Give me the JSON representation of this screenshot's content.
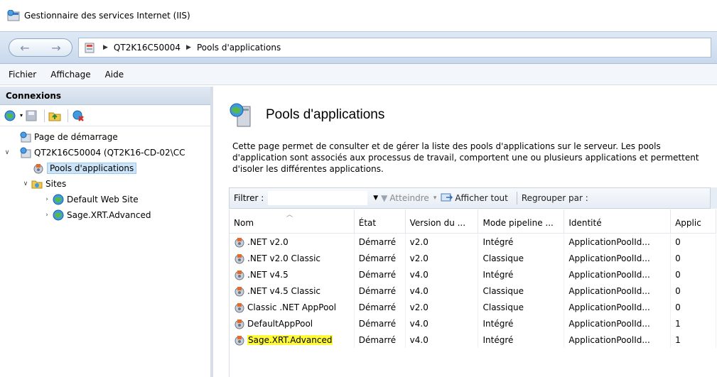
{
  "window": {
    "title": "Gestionnaire des services Internet (IIS)"
  },
  "address": {
    "crumbs": [
      "QT2K16C50004",
      "Pools d'applications"
    ]
  },
  "menu": {
    "items": [
      "Fichier",
      "Affichage",
      "Aide"
    ]
  },
  "connections": {
    "header": "Connexions",
    "tree": {
      "start_page": "Page de démarrage",
      "server": "QT2K16C50004 (QT2K16-CD-02\\CC",
      "app_pools": "Pools d'applications",
      "sites": "Sites",
      "site1": "Default Web Site",
      "site2": "Sage.XRT.Advanced"
    }
  },
  "main": {
    "title": "Pools d'applications",
    "description": "Cette page permet de consulter et de gérer la liste des pools d'applications sur le serveur. Les pools d'application sont associés aux processus de travail, comportent une ou plusieurs applications et permettent d'isoler les différentes applications.",
    "filter": {
      "label": "Filtrer :",
      "go_label": "Atteindre",
      "show_all_label": "Afficher tout",
      "group_label": "Regrouper par :"
    },
    "columns": [
      "Nom",
      "État",
      "Version du ...",
      "Mode pipeline ...",
      "Identité",
      "Applic"
    ],
    "rows": [
      {
        "name": ".NET v2.0",
        "state": "Démarré",
        "version": "v2.0",
        "pipeline": "Intégré",
        "identity": "ApplicationPoolId...",
        "apps": "0"
      },
      {
        "name": ".NET v2.0 Classic",
        "state": "Démarré",
        "version": "v2.0",
        "pipeline": "Classique",
        "identity": "ApplicationPoolId...",
        "apps": "0"
      },
      {
        "name": ".NET v4.5",
        "state": "Démarré",
        "version": "v4.0",
        "pipeline": "Intégré",
        "identity": "ApplicationPoolId...",
        "apps": "0"
      },
      {
        "name": ".NET v4.5 Classic",
        "state": "Démarré",
        "version": "v4.0",
        "pipeline": "Classique",
        "identity": "ApplicationPoolId...",
        "apps": "0"
      },
      {
        "name": "Classic .NET AppPool",
        "state": "Démarré",
        "version": "v2.0",
        "pipeline": "Classique",
        "identity": "ApplicationPoolId...",
        "apps": "0"
      },
      {
        "name": "DefaultAppPool",
        "state": "Démarré",
        "version": "v4.0",
        "pipeline": "Intégré",
        "identity": "ApplicationPoolId...",
        "apps": "1"
      },
      {
        "name": "Sage.XRT.Advanced",
        "state": "Démarré",
        "version": "v4.0",
        "pipeline": "Intégré",
        "identity": "ApplicationPoolId...",
        "apps": "1",
        "highlighted": true
      }
    ]
  },
  "colors": {
    "highlight": "#fffb3a",
    "selection": "#cce4f7",
    "chrome": "#dfe9f5"
  }
}
